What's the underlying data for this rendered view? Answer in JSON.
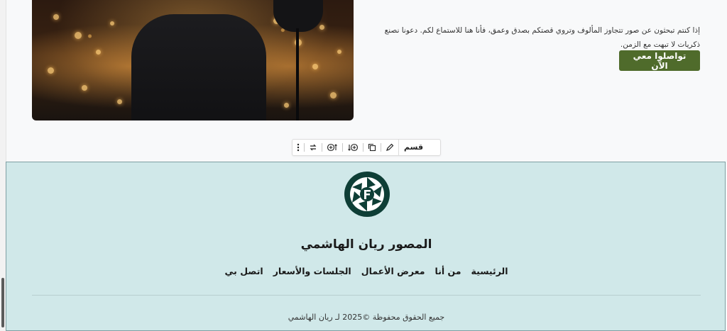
{
  "hero": {
    "paragraph": "إذا كنتم تبحثون عن صور تتجاوز المألوف وتروي قصتكم بصدق وعمق، فأنا هنا للاستماع لكم. دعونا نصنع ذكريات لا تبهت مع الزمن.",
    "cta_label": "تواصلوا معي الآن",
    "cta_color": "#4f6b2b"
  },
  "toolbar": {
    "block_label": "قسم",
    "icons": [
      "more-vertical-icon",
      "transform-icon",
      "insert-before-icon",
      "insert-after-icon",
      "duplicate-icon",
      "edit-icon"
    ]
  },
  "footer": {
    "background": "#d0e8e9",
    "logo_color": "#0e3e36",
    "title": "المصور ريان الهاشمي",
    "nav": [
      "الرئيسية",
      "من أنا",
      "معرض الأعمال",
      "الجلسات والأسعار",
      "اتصل بي"
    ],
    "copyright": "جميع الحقوق محفوظة ©2025 لـ ريان الهاشمي"
  }
}
